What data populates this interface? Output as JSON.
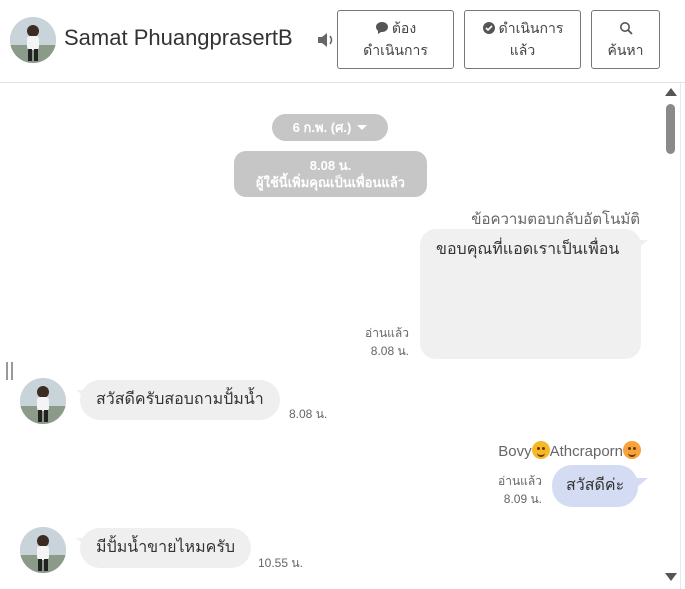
{
  "header": {
    "contact_name": "Samat PhuangprasertB",
    "buttons": {
      "follow_up_line1": "ต้อง",
      "follow_up_line2": "ดำเนินการ",
      "done_line1": "ดำเนินการ",
      "done_line2": "แล้ว",
      "search": "ค้นหา"
    }
  },
  "chat": {
    "date_pill": "6 ก.พ. (ศ.)",
    "system_note": {
      "time": "8.08 น.",
      "text": "ผู้ใช้นี้เพิ่มคุณเป็นเพื่อนแล้ว"
    },
    "messages": [
      {
        "direction": "out",
        "sender": "ข้อความตอบกลับอัตโนมัติ",
        "text": "ขอบคุณที่แอดเราเป็นเพื่อน",
        "read": "อ่านแล้ว",
        "time": "8.08 น."
      },
      {
        "direction": "in",
        "text": "สวัสดีครับสอบถามปั้มน้ำ",
        "time": "8.08 น."
      },
      {
        "direction": "out",
        "sender_prefix": "Bovy",
        "sender_main": "Athcraporn",
        "text": "สวัสดีค่ะ",
        "read": "อ่านแล้ว",
        "time": "8.09 น."
      },
      {
        "direction": "in",
        "text": "มีปั้มน้ำขายไหมครับ",
        "time": "10.55 น."
      }
    ]
  },
  "icons": [
    "avatar",
    "speaker-icon",
    "chat-bubble-icon",
    "check-bubble-icon",
    "search-icon",
    "scroll-up-arrow",
    "scroll-down-arrow",
    "hug-emoji-icon",
    "blush-emoji-icon"
  ],
  "colors": {
    "system_pill": "#c6c6c6",
    "outgoing_bubble": "#f0f0f0",
    "staff_bubble": "#d4dcf3",
    "incoming_bubble": "#efefef"
  }
}
